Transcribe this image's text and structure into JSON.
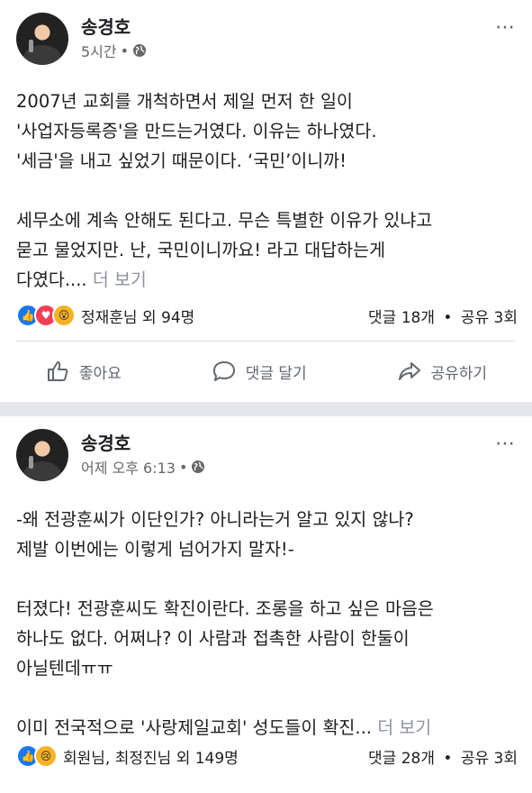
{
  "posts": [
    {
      "author": "송경호",
      "time": "5시간",
      "paragraphs": [
        "2007년 교회를 개척하면서 제일 먼저 한 일이\n'사업자등록증'을 만드는거였다. 이유는 하나였다.\n'세금'을 내고 싶었기 때문이다. ‘국민’이니까!",
        "세무소에 계속 안해도 된다고. 무슨 특별한 이유가 있냐고\n묻고 물었지만. 난, 국민이니까요! 라고 대답하는게\n다였다...."
      ],
      "see_more": "더 보기",
      "reactions_text": "정재훈님 외 94명",
      "comments": "댓글 18개",
      "shares": "공유 3회",
      "like_label": "좋아요",
      "comment_label": "댓글 달기",
      "share_label": "공유하기"
    },
    {
      "author": "송경호",
      "time": "어제 오후 6:13",
      "paragraphs": [
        "-왜 전광훈씨가 이단인가? 아니라는거 알고 있지 않나?\n제발 이번에는 이렇게 넘어가지 말자!-",
        "터졌다! 전광훈씨도 확진이란다. 조롱을 하고 싶은 마음은\n하나도 없다. 어쩌나? 이 사람과 접촉한 사람이 한둘이\n아닐텐데ㅠㅠ",
        "이미 전국적으로 '사랑제일교회' 성도들이 확진..."
      ],
      "see_more": "더 보기",
      "reactions_text": "회원님, 최정진님 외 149명",
      "comments": "댓글 28개",
      "shares": "공유 3회"
    }
  ],
  "separator": "•",
  "more_icon": "⋯",
  "colors": {
    "like": "#1877f2",
    "love": "#f33e58",
    "wow": "#f7b125",
    "muted": "#65676b"
  }
}
